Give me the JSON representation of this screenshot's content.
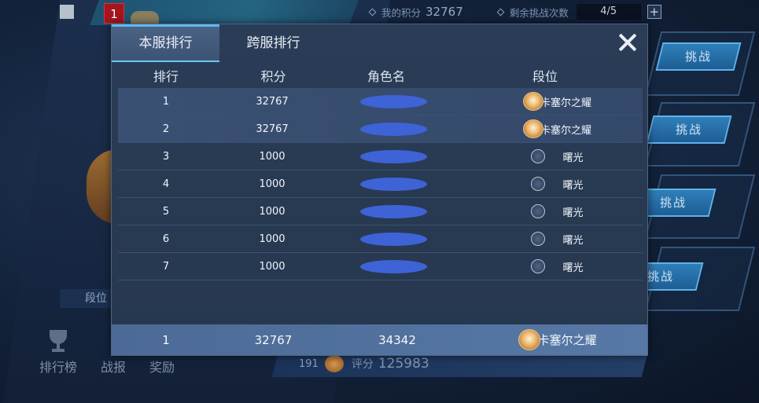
{
  "background": {
    "badge_number": "1",
    "my_score_label": "我的积分",
    "my_score_value": "32767",
    "remaining_label": "剩余挑战次数",
    "remaining_value": "4/5",
    "plus_label": "+",
    "challenge_label": "挑战",
    "rank_label": "段位",
    "nav": [
      {
        "label": "排行榜",
        "icon": "trophy-icon"
      },
      {
        "label": "战报"
      },
      {
        "label": "奖励"
      }
    ],
    "bottom_level": "191",
    "rating_label": "评分",
    "rating_value": "125983"
  },
  "modal": {
    "tabs": [
      {
        "label": "本服排行",
        "active": true
      },
      {
        "label": "跨服排行",
        "active": false
      }
    ],
    "close_icon": "close-icon",
    "headers": {
      "rank": "排行",
      "score": "积分",
      "name": "角色名",
      "tier": "段位"
    },
    "rows": [
      {
        "rank": "1",
        "score": "32767",
        "tier": "卡塞尔之耀",
        "tier_icon": "gold-badge-icon"
      },
      {
        "rank": "2",
        "score": "32767",
        "tier": "卡塞尔之耀",
        "tier_icon": "gold-badge-icon"
      },
      {
        "rank": "3",
        "score": "1000",
        "tier": "曙光",
        "tier_icon": "silver-badge-icon"
      },
      {
        "rank": "4",
        "score": "1000",
        "tier": "曙光",
        "tier_icon": "silver-badge-icon"
      },
      {
        "rank": "5",
        "score": "1000",
        "tier": "曙光",
        "tier_icon": "silver-badge-icon"
      },
      {
        "rank": "6",
        "score": "1000",
        "tier": "曙光",
        "tier_icon": "silver-badge-icon"
      },
      {
        "rank": "7",
        "score": "1000",
        "tier": "曙光",
        "tier_icon": "silver-badge-icon"
      }
    ],
    "self_row": {
      "rank": "1",
      "score": "32767",
      "name": "34342",
      "tier": "卡塞尔之耀",
      "tier_icon": "gold-badge-icon"
    }
  },
  "colors": {
    "accent": "#5fb8f0",
    "name_mask": "#3e63d6",
    "gold_badge": "#e9b46a"
  }
}
